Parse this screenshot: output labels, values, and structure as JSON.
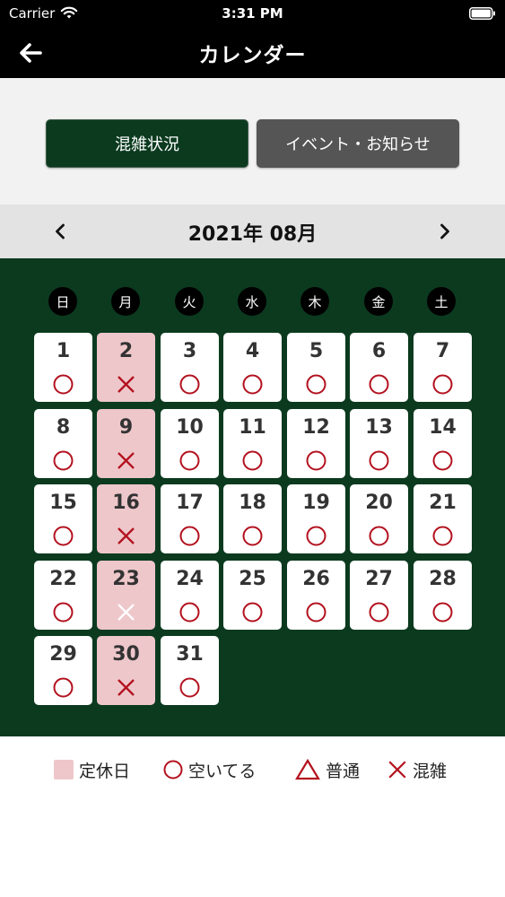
{
  "status_bar": {
    "carrier": "Carrier",
    "time": "3:31 PM"
  },
  "nav": {
    "title": "カレンダー",
    "back_icon": "arrow-left-icon"
  },
  "tabs": [
    {
      "label": "混雑状況",
      "active": true
    },
    {
      "label": "イベント・お知らせ",
      "active": false
    }
  ],
  "month": {
    "label": "2021年 08月",
    "prev_icon": "chevron-left-icon",
    "next_icon": "chevron-right-icon"
  },
  "weekdays": [
    "日",
    "月",
    "火",
    "水",
    "木",
    "金",
    "土"
  ],
  "colors": {
    "calendar_bg": "#0b3a1f",
    "holiday_bg": "#eec7cb",
    "status_red": "#b3111e",
    "event_tab_bg": "#555555"
  },
  "days": [
    {
      "num": "1",
      "holiday": false,
      "status": "open"
    },
    {
      "num": "2",
      "holiday": true,
      "status": "crowded"
    },
    {
      "num": "3",
      "holiday": false,
      "status": "open"
    },
    {
      "num": "4",
      "holiday": false,
      "status": "open"
    },
    {
      "num": "5",
      "holiday": false,
      "status": "open"
    },
    {
      "num": "6",
      "holiday": false,
      "status": "open"
    },
    {
      "num": "7",
      "holiday": false,
      "status": "open"
    },
    {
      "num": "8",
      "holiday": false,
      "status": "open"
    },
    {
      "num": "9",
      "holiday": true,
      "status": "crowded"
    },
    {
      "num": "10",
      "holiday": false,
      "status": "open"
    },
    {
      "num": "11",
      "holiday": false,
      "status": "open"
    },
    {
      "num": "12",
      "holiday": false,
      "status": "open"
    },
    {
      "num": "13",
      "holiday": false,
      "status": "open"
    },
    {
      "num": "14",
      "holiday": false,
      "status": "open"
    },
    {
      "num": "15",
      "holiday": false,
      "status": "open"
    },
    {
      "num": "16",
      "holiday": true,
      "status": "crowded"
    },
    {
      "num": "17",
      "holiday": false,
      "status": "open"
    },
    {
      "num": "18",
      "holiday": false,
      "status": "open"
    },
    {
      "num": "19",
      "holiday": false,
      "status": "open"
    },
    {
      "num": "20",
      "holiday": false,
      "status": "open"
    },
    {
      "num": "21",
      "holiday": false,
      "status": "open"
    },
    {
      "num": "22",
      "holiday": false,
      "status": "open"
    },
    {
      "num": "23",
      "holiday": true,
      "status": "crowded-light"
    },
    {
      "num": "24",
      "holiday": false,
      "status": "open"
    },
    {
      "num": "25",
      "holiday": false,
      "status": "open"
    },
    {
      "num": "26",
      "holiday": false,
      "status": "open"
    },
    {
      "num": "27",
      "holiday": false,
      "status": "open"
    },
    {
      "num": "28",
      "holiday": false,
      "status": "open"
    },
    {
      "num": "29",
      "holiday": false,
      "status": "open"
    },
    {
      "num": "30",
      "holiday": true,
      "status": "crowded"
    },
    {
      "num": "31",
      "holiday": false,
      "status": "open"
    }
  ],
  "legend": [
    {
      "label": "定休日",
      "icon": "holiday-swatch"
    },
    {
      "label": "空いてる",
      "icon": "circle-icon"
    },
    {
      "label": "普通",
      "icon": "triangle-icon"
    },
    {
      "label": "混雑",
      "icon": "cross-icon"
    }
  ]
}
